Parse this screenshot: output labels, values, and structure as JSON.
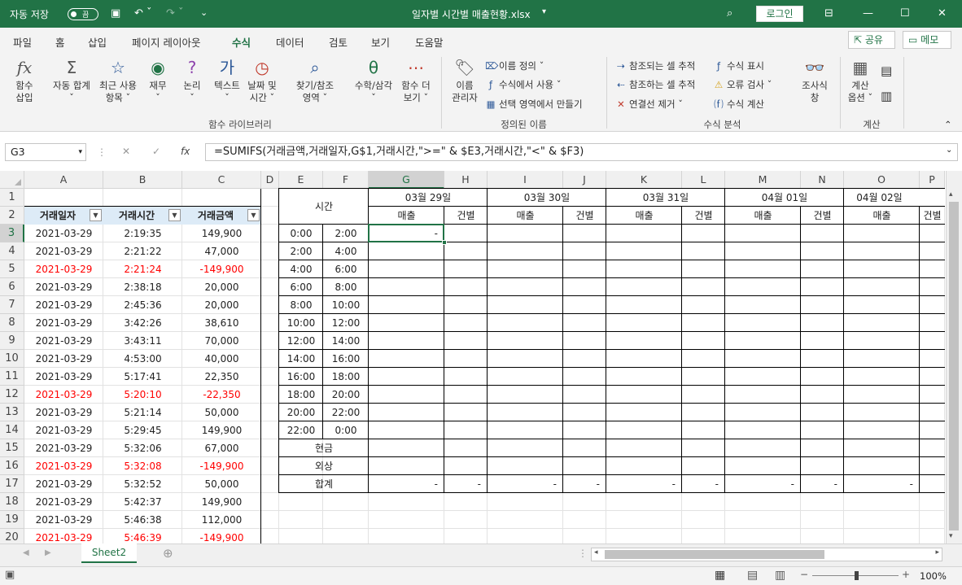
{
  "titlebar": {
    "autosave": "자동 저장",
    "toggle": "끔",
    "filename": "일자별 시간별 매출현황.xlsx",
    "login": "로그인"
  },
  "menu": {
    "tabs": [
      "파일",
      "홈",
      "삽입",
      "페이지 레이아웃",
      "수식",
      "데이터",
      "검토",
      "보기",
      "도움말"
    ],
    "share": "공유",
    "memo": "메모"
  },
  "ribbon": {
    "insert_function": [
      "함수",
      "삽입"
    ],
    "buttons": [
      [
        "자동 합계",
        "ˇ"
      ],
      [
        "최근 사용",
        "항목 ˇ"
      ],
      [
        "재무",
        "ˇ"
      ],
      [
        "논리",
        "ˇ"
      ],
      [
        "텍스트",
        "ˇ"
      ],
      [
        "날짜 및",
        "시간 ˇ"
      ],
      [
        "찾기/참조",
        "영역 ˇ"
      ],
      [
        "수학/삼각",
        "ˇ"
      ],
      [
        "함수 더",
        "보기 ˇ"
      ]
    ],
    "library_label": "함수 라이브러리",
    "name_manager": [
      "이름",
      "관리자"
    ],
    "define_name": "이름 정의",
    "use_in_formula": "수식에서 사용",
    "create_from_selection": "선택 영역에서 만들기",
    "defined_names_label": "정의된 이름",
    "trace_precedents": "참조되는 셀 추적",
    "trace_dependents": "참조하는 셀 추적",
    "remove_arrows": "연결선 제거",
    "show_formulas": "수식 표시",
    "error_checking": "오류 검사",
    "evaluate_formula": "수식 계산",
    "watch_window": [
      "조사식",
      "창"
    ],
    "auditing_label": "수식 분석",
    "calc_options": [
      "계산",
      "옵션 ˇ"
    ],
    "calculation_label": "계산"
  },
  "formula_bar": {
    "name_box": "G3",
    "formula": "=SUMIFS(거래금액,거래일자,G$1,거래시간,\">=\" & $E3,거래시간,\"<\" & $F3)"
  },
  "columns": [
    "A",
    "B",
    "C",
    "D",
    "E",
    "F",
    "G",
    "H",
    "I",
    "J",
    "K",
    "L",
    "M",
    "N",
    "O",
    "P"
  ],
  "rows": [
    "1",
    "2",
    "3",
    "4",
    "5",
    "6",
    "7",
    "8",
    "9",
    "10",
    "11",
    "12",
    "13",
    "14",
    "15",
    "16",
    "17",
    "18",
    "19",
    "20"
  ],
  "table_headers": [
    "거래일자",
    "거래시간",
    "거래금액"
  ],
  "transactions": [
    [
      "2021-03-29",
      "2:19:35",
      "149,900"
    ],
    [
      "2021-03-29",
      "2:21:22",
      "47,000"
    ],
    [
      "2021-03-29",
      "2:21:24",
      "-149,900"
    ],
    [
      "2021-03-29",
      "2:38:18",
      "20,000"
    ],
    [
      "2021-03-29",
      "2:45:36",
      "20,000"
    ],
    [
      "2021-03-29",
      "3:42:26",
      "38,610"
    ],
    [
      "2021-03-29",
      "3:43:11",
      "70,000"
    ],
    [
      "2021-03-29",
      "4:53:00",
      "40,000"
    ],
    [
      "2021-03-29",
      "5:17:41",
      "22,350"
    ],
    [
      "2021-03-29",
      "5:20:10",
      "-22,350"
    ],
    [
      "2021-03-29",
      "5:21:14",
      "50,000"
    ],
    [
      "2021-03-29",
      "5:29:45",
      "149,900"
    ],
    [
      "2021-03-29",
      "5:32:06",
      "67,000"
    ],
    [
      "2021-03-29",
      "5:32:08",
      "-149,900"
    ],
    [
      "2021-03-29",
      "5:32:52",
      "50,000"
    ],
    [
      "2021-03-29",
      "5:42:37",
      "149,900"
    ],
    [
      "2021-03-29",
      "5:46:38",
      "112,000"
    ],
    [
      "2021-03-29",
      "5:46:39",
      "-149,900"
    ]
  ],
  "red_rows": [
    2,
    9,
    13,
    17
  ],
  "summary": {
    "time_header": "시간",
    "dates": [
      "03월 29일",
      "03월 30일",
      "03월 31일",
      "04월 01일",
      "04월 02일"
    ],
    "sales": "매출",
    "count": "건별",
    "time_ranges": [
      [
        "0:00",
        "2:00"
      ],
      [
        "2:00",
        "4:00"
      ],
      [
        "4:00",
        "6:00"
      ],
      [
        "6:00",
        "8:00"
      ],
      [
        "8:00",
        "10:00"
      ],
      [
        "10:00",
        "12:00"
      ],
      [
        "12:00",
        "14:00"
      ],
      [
        "14:00",
        "16:00"
      ],
      [
        "16:00",
        "18:00"
      ],
      [
        "18:00",
        "20:00"
      ],
      [
        "20:00",
        "22:00"
      ],
      [
        "22:00",
        "0:00"
      ]
    ],
    "cash": "현금",
    "credit": "외상",
    "total": "합계",
    "dash": "-"
  },
  "sheet_tabs": [
    "Sheet2"
  ],
  "status": {
    "zoom": "100%"
  },
  "colors": {
    "accent": "#217346",
    "negative": "#ff0000",
    "header_fill": "#ddebf7"
  }
}
